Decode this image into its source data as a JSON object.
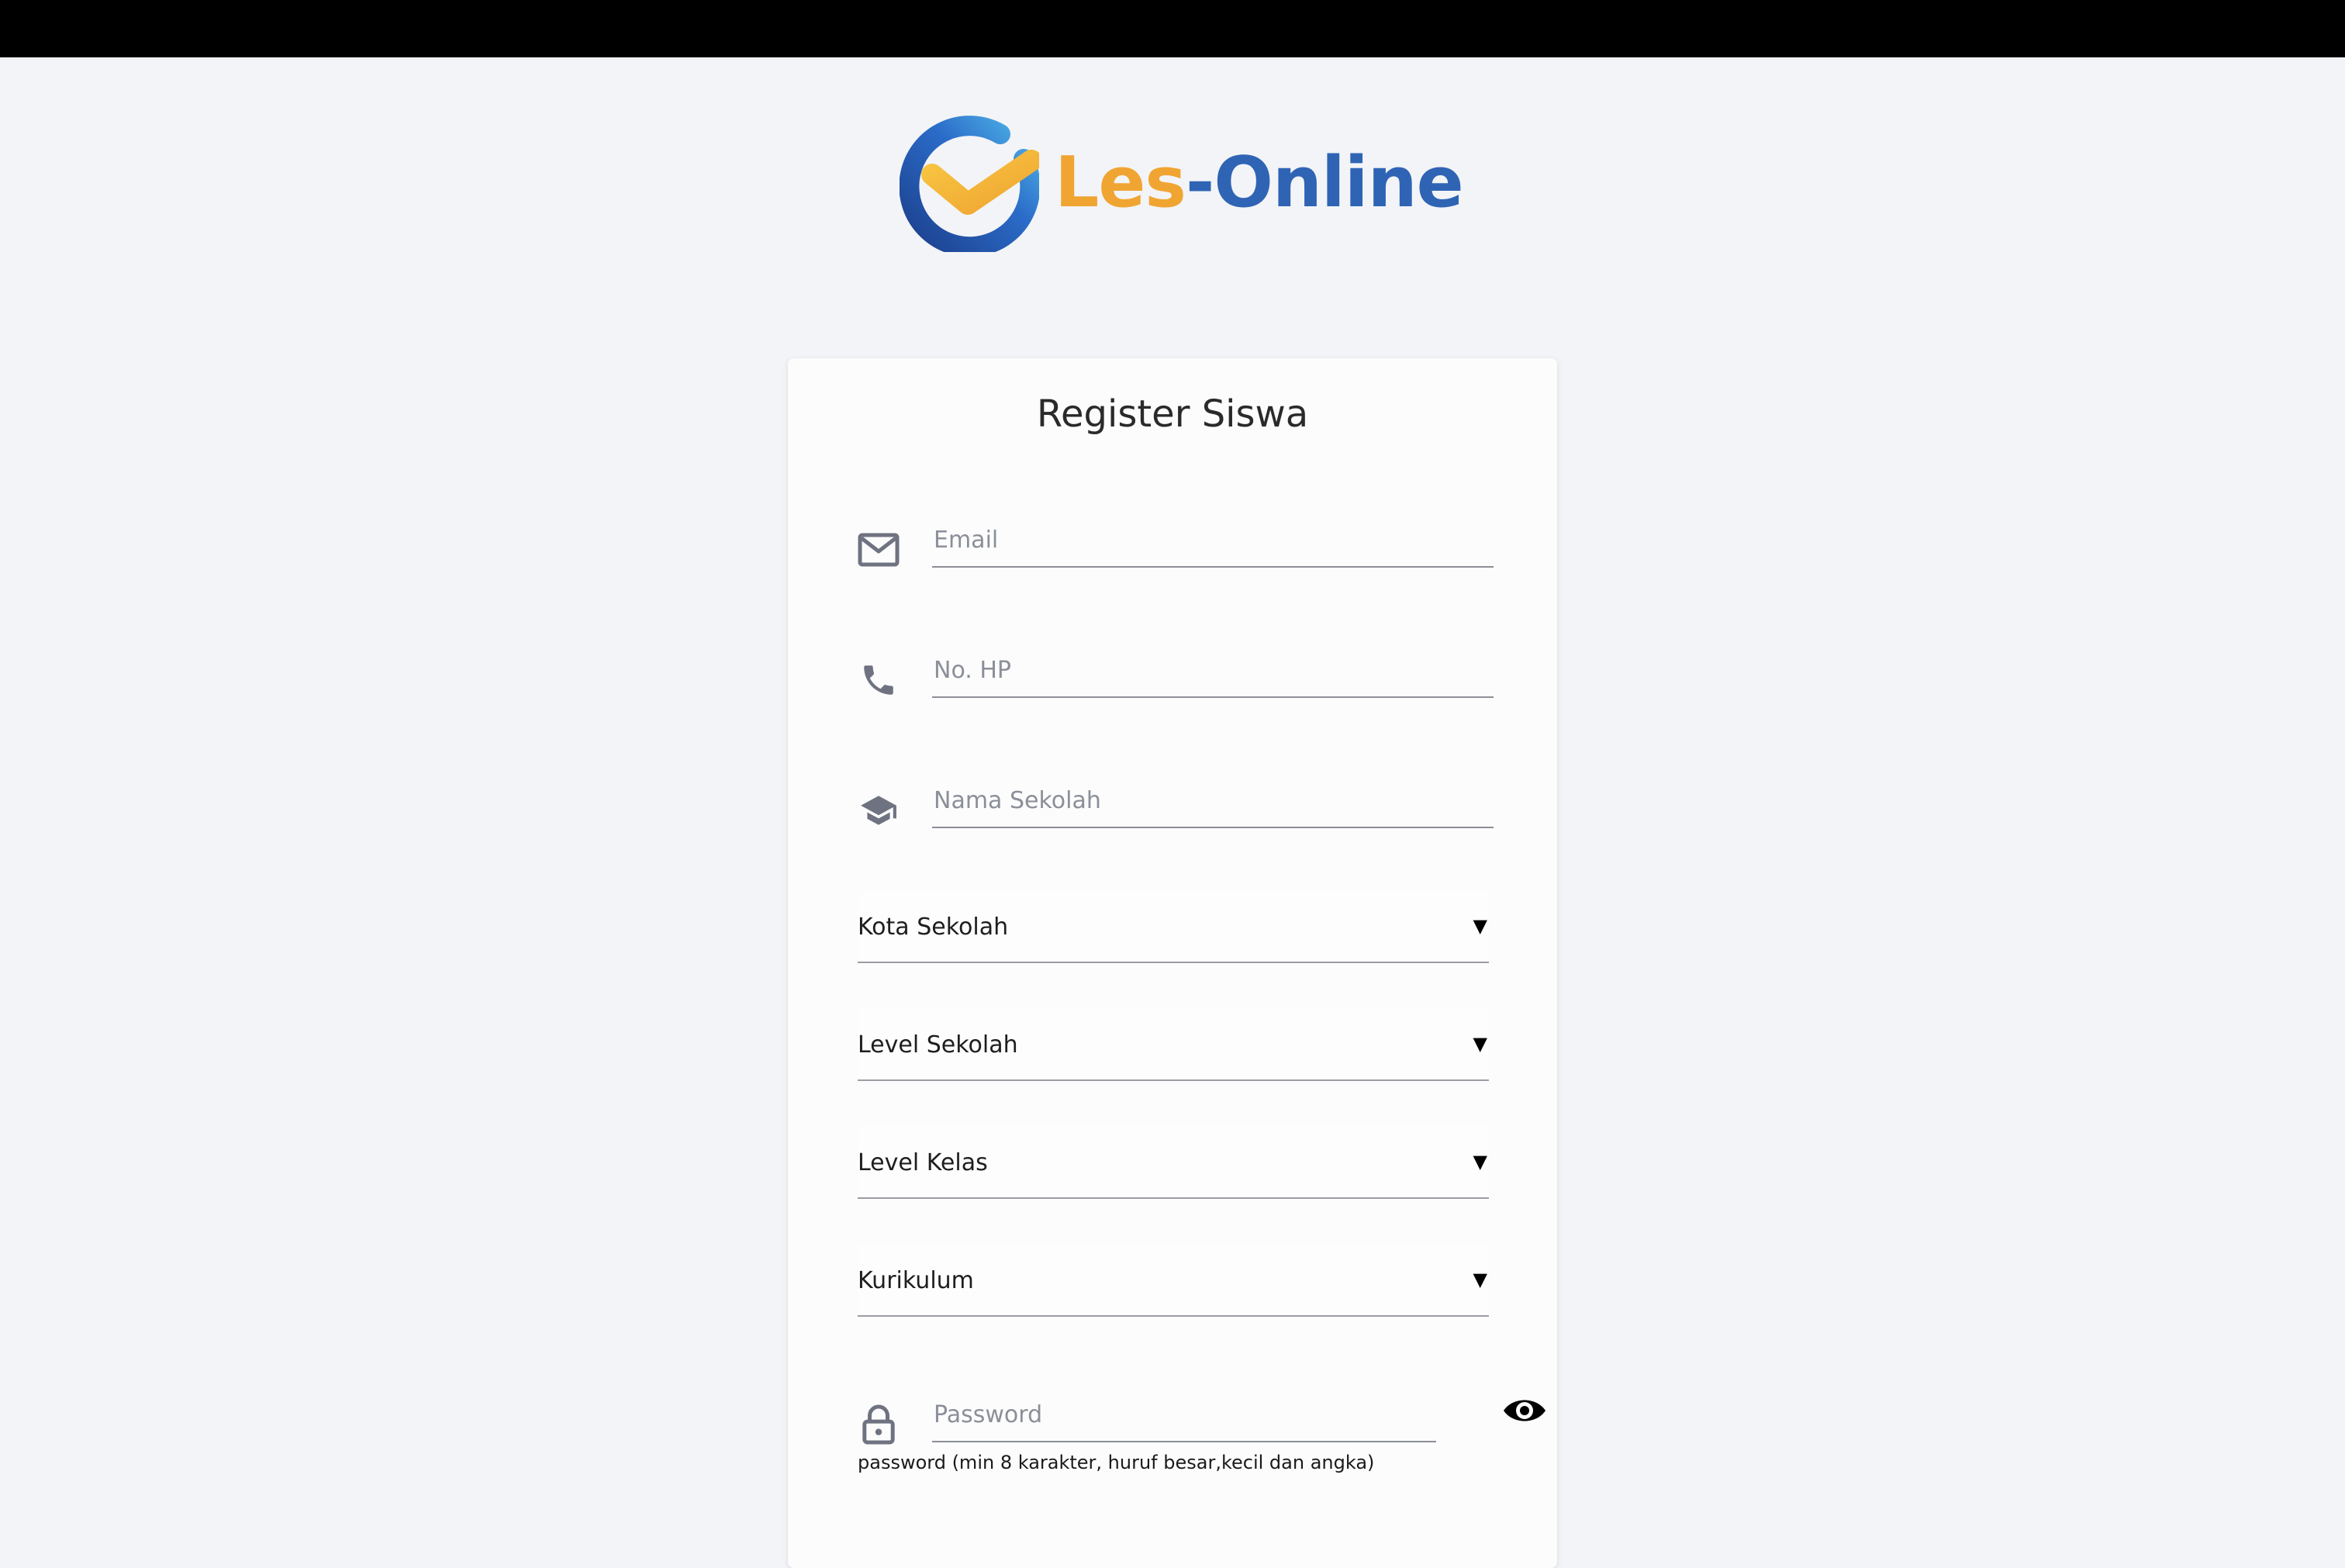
{
  "brand": {
    "name_part1": "Les",
    "name_part2": "-Online",
    "colors": {
      "blue": "#2f64b5",
      "orange": "#f0a532"
    }
  },
  "form": {
    "title": "Register Siswa",
    "email": {
      "placeholder": "Email",
      "icon": "mail-icon"
    },
    "phone": {
      "placeholder": "No. HP",
      "icon": "phone-icon"
    },
    "school_name": {
      "placeholder": "Nama Sekolah",
      "icon": "graduation-cap-icon"
    },
    "school_city": {
      "label": "Kota Sekolah",
      "caret": "▼"
    },
    "school_level": {
      "label": "Level Sekolah",
      "caret": "▼"
    },
    "class_level": {
      "label": "Level Kelas",
      "caret": "▼"
    },
    "curriculum": {
      "label": "Kurikulum",
      "caret": "▼"
    },
    "password": {
      "placeholder": "Password",
      "icon": "lock-icon",
      "toggle_icon": "eye-icon",
      "hint": "password (min 8 karakter, huruf besar,kecil dan angka)"
    }
  }
}
